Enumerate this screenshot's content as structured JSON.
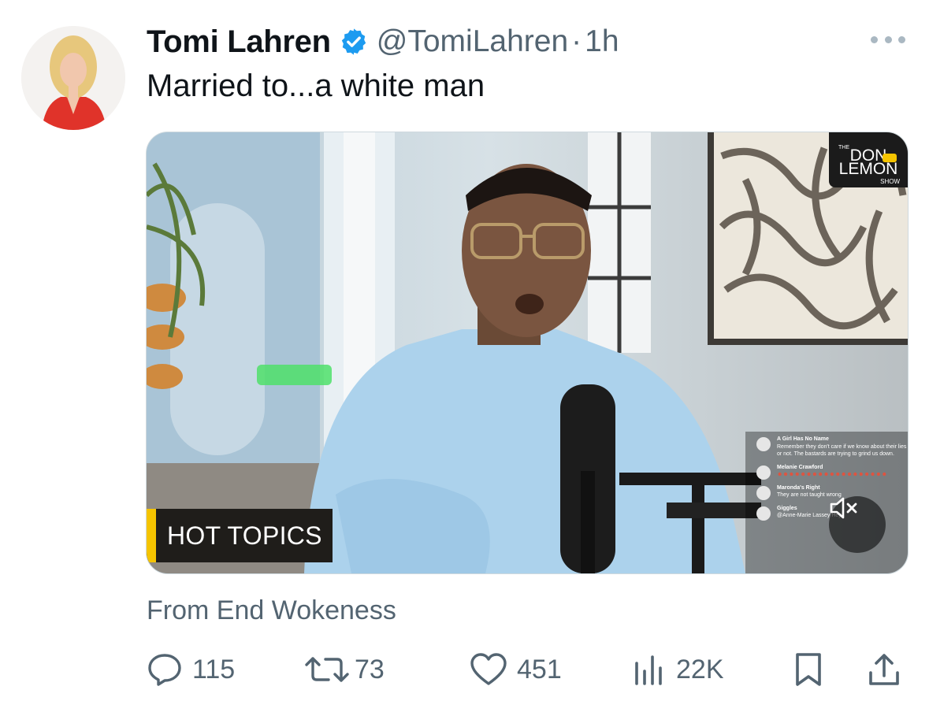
{
  "tweet": {
    "author_name": "Tomi Lahren",
    "author_handle": "@TomiLahren",
    "separator": "·",
    "timestamp": "1h",
    "text": "Married to...a white man",
    "source": "From End Wokeness"
  },
  "video": {
    "overlay_label": "HOT TOPICS",
    "logo": {
      "the": "THE",
      "line1": "DON",
      "line2": "LEMON",
      "line3": "SHOW"
    },
    "chat": [
      {
        "name": "A Girl Has No Name",
        "text": "Remember they don't care if we know about their lies or not. The bastards are trying to grind us down."
      },
      {
        "name": "Melanie Crawford",
        "text": ""
      },
      {
        "name": "Maronda's Right",
        "text": "They are not taught wrong"
      },
      {
        "name": "Giggles",
        "text": "@Anne-Marie Lassey Hey"
      }
    ]
  },
  "actions": {
    "replies": "115",
    "reposts": "73",
    "likes": "451",
    "views": "22K"
  },
  "icons": {
    "verified": "verified-badge-icon",
    "more": "more-options-icon",
    "reply": "reply-icon",
    "repost": "repost-icon",
    "like": "heart-icon",
    "views": "views-chart-icon",
    "bookmark": "bookmark-icon",
    "share": "share-icon",
    "mute": "muted-speaker-icon"
  },
  "colors": {
    "verified_blue": "#1d9bf0",
    "muted_text": "#536471",
    "hot_topics_accent": "#f5c400"
  }
}
